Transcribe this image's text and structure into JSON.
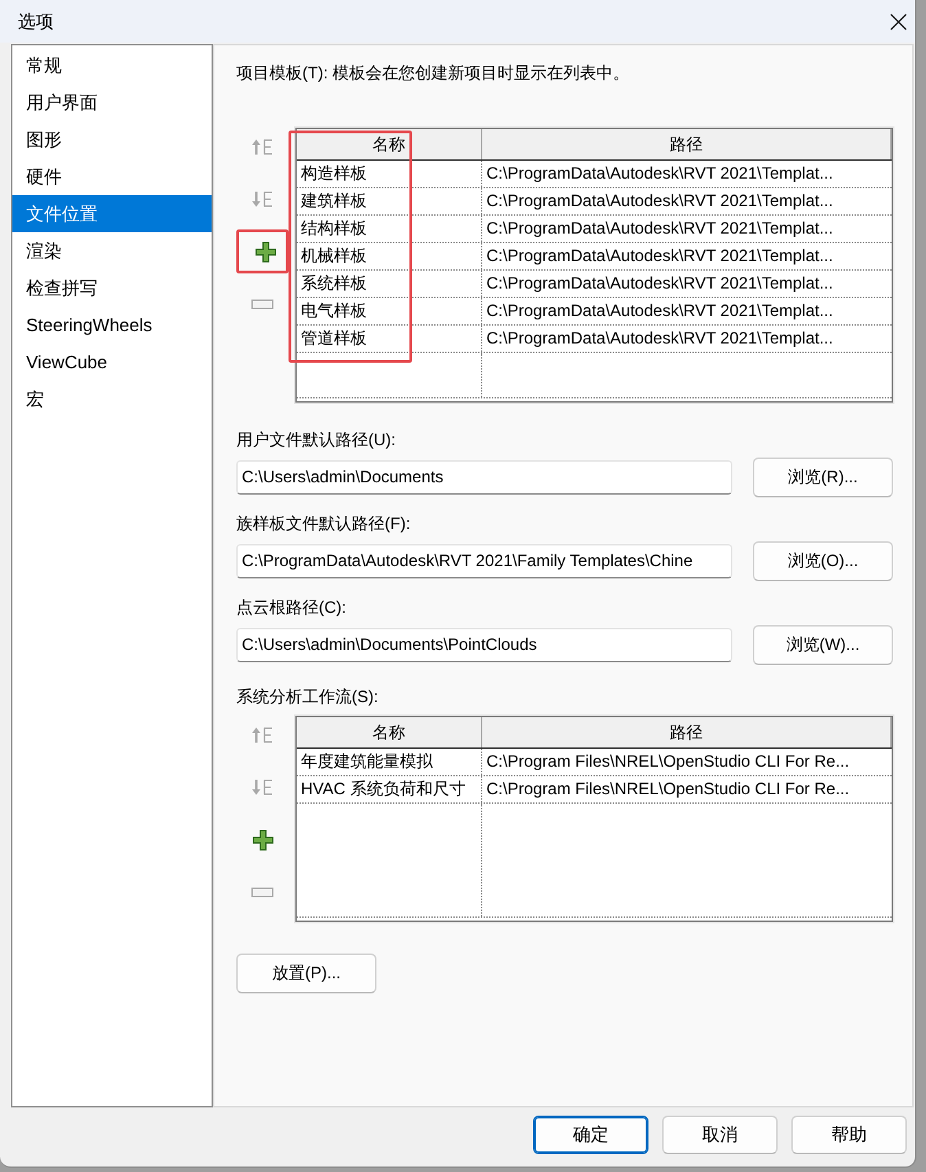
{
  "window": {
    "title": "选项"
  },
  "sidebar": {
    "items": [
      {
        "label": "常规",
        "selected": false
      },
      {
        "label": "用户界面",
        "selected": false
      },
      {
        "label": "图形",
        "selected": false
      },
      {
        "label": "硬件",
        "selected": false
      },
      {
        "label": "文件位置",
        "selected": true
      },
      {
        "label": "渲染",
        "selected": false
      },
      {
        "label": "检查拼写",
        "selected": false
      },
      {
        "label": "SteeringWheels",
        "selected": false
      },
      {
        "label": "ViewCube",
        "selected": false
      },
      {
        "label": "宏",
        "selected": false
      }
    ]
  },
  "project_templates": {
    "label": "项目模板(T): 模板会在您创建新项目时显示在列表中。",
    "tools": [
      {
        "kind": "move_up",
        "disabled": true,
        "highlighted": false
      },
      {
        "kind": "move_down",
        "disabled": true,
        "highlighted": false
      },
      {
        "kind": "add",
        "disabled": false,
        "highlighted": true
      },
      {
        "kind": "remove",
        "disabled": true,
        "highlighted": false
      }
    ],
    "table": {
      "columns": [
        {
          "label": "名称",
          "highlighted": true
        },
        {
          "label": "路径",
          "highlighted": false
        }
      ],
      "rows": [
        {
          "name": "构造样板",
          "path": "C:\\ProgramData\\Autodesk\\RVT 2021\\Templat..."
        },
        {
          "name": "建筑样板",
          "path": "C:\\ProgramData\\Autodesk\\RVT 2021\\Templat..."
        },
        {
          "name": "结构样板",
          "path": "C:\\ProgramData\\Autodesk\\RVT 2021\\Templat..."
        },
        {
          "name": "机械样板",
          "path": "C:\\ProgramData\\Autodesk\\RVT 2021\\Templat..."
        },
        {
          "name": "系统样板",
          "path": "C:\\ProgramData\\Autodesk\\RVT 2021\\Templat..."
        },
        {
          "name": "电气样板",
          "path": "C:\\ProgramData\\Autodesk\\RVT 2021\\Templat..."
        },
        {
          "name": "管道样板",
          "path": "C:\\ProgramData\\Autodesk\\RVT 2021\\Templat..."
        }
      ]
    }
  },
  "paths": [
    {
      "label": "用户文件默认路径(U):",
      "value": "C:\\Users\\admin\\Documents",
      "button": "浏览(R)..."
    },
    {
      "label": "族样板文件默认路径(F):",
      "value": "C:\\ProgramData\\Autodesk\\RVT 2021\\Family Templates\\Chine",
      "button": "浏览(O)..."
    },
    {
      "label": "点云根路径(C):",
      "value": "C:\\Users\\admin\\Documents\\PointClouds",
      "button": "浏览(W)..."
    }
  ],
  "analysis_workflows": {
    "label": "系统分析工作流(S):",
    "tools": [
      {
        "kind": "move_up",
        "disabled": true,
        "highlighted": false
      },
      {
        "kind": "move_down",
        "disabled": true,
        "highlighted": false
      },
      {
        "kind": "add",
        "disabled": false,
        "highlighted": false
      },
      {
        "kind": "remove",
        "disabled": true,
        "highlighted": false
      }
    ],
    "table": {
      "columns": [
        {
          "label": "名称",
          "highlighted": false
        },
        {
          "label": "路径",
          "highlighted": false
        }
      ],
      "rows": [
        {
          "name": "年度建筑能量模拟",
          "path": "C:\\Program Files\\NREL\\OpenStudio CLI For Re..."
        },
        {
          "name": "HVAC 系统负荷和尺寸",
          "path": "C:\\Program Files\\NREL\\OpenStudio CLI For Re..."
        }
      ]
    }
  },
  "place_button": "放置(P)...",
  "footer": {
    "buttons": [
      {
        "label": "确定",
        "default": true
      },
      {
        "label": "取消",
        "default": false
      },
      {
        "label": "帮助",
        "default": false
      }
    ]
  }
}
